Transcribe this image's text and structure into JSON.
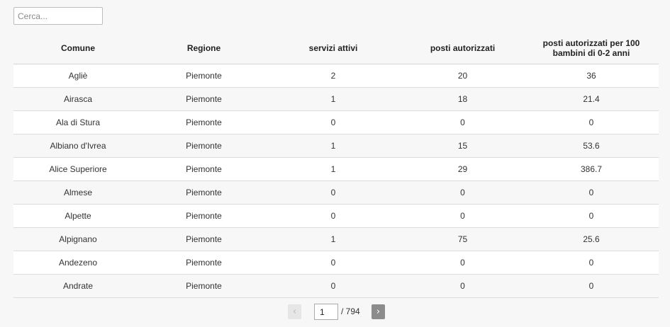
{
  "search": {
    "placeholder": "Cerca..."
  },
  "table": {
    "headers": {
      "comune": "Comune",
      "regione": "Regione",
      "servizi": "servizi attivi",
      "posti": "posti autorizzati",
      "posti100": "posti autorizzati per 100 bambini di 0-2 anni"
    },
    "rows": [
      {
        "comune": "Agliè",
        "regione": "Piemonte",
        "servizi": "2",
        "posti": "20",
        "posti100": "36"
      },
      {
        "comune": "Airasca",
        "regione": "Piemonte",
        "servizi": "1",
        "posti": "18",
        "posti100": "21.4"
      },
      {
        "comune": "Ala di Stura",
        "regione": "Piemonte",
        "servizi": "0",
        "posti": "0",
        "posti100": "0"
      },
      {
        "comune": "Albiano d'Ivrea",
        "regione": "Piemonte",
        "servizi": "1",
        "posti": "15",
        "posti100": "53.6"
      },
      {
        "comune": "Alice Superiore",
        "regione": "Piemonte",
        "servizi": "1",
        "posti": "29",
        "posti100": "386.7"
      },
      {
        "comune": "Almese",
        "regione": "Piemonte",
        "servizi": "0",
        "posti": "0",
        "posti100": "0"
      },
      {
        "comune": "Alpette",
        "regione": "Piemonte",
        "servizi": "0",
        "posti": "0",
        "posti100": "0"
      },
      {
        "comune": "Alpignano",
        "regione": "Piemonte",
        "servizi": "1",
        "posti": "75",
        "posti100": "25.6"
      },
      {
        "comune": "Andezeno",
        "regione": "Piemonte",
        "servizi": "0",
        "posti": "0",
        "posti100": "0"
      },
      {
        "comune": "Andrate",
        "regione": "Piemonte",
        "servizi": "0",
        "posti": "0",
        "posti100": "0"
      }
    ]
  },
  "pagination": {
    "prev_icon": "chevron-left-icon",
    "prev_glyph": "‹",
    "next_icon": "chevron-right-icon",
    "next_glyph": "›",
    "current_page": "1",
    "total_label": "/ 794"
  }
}
